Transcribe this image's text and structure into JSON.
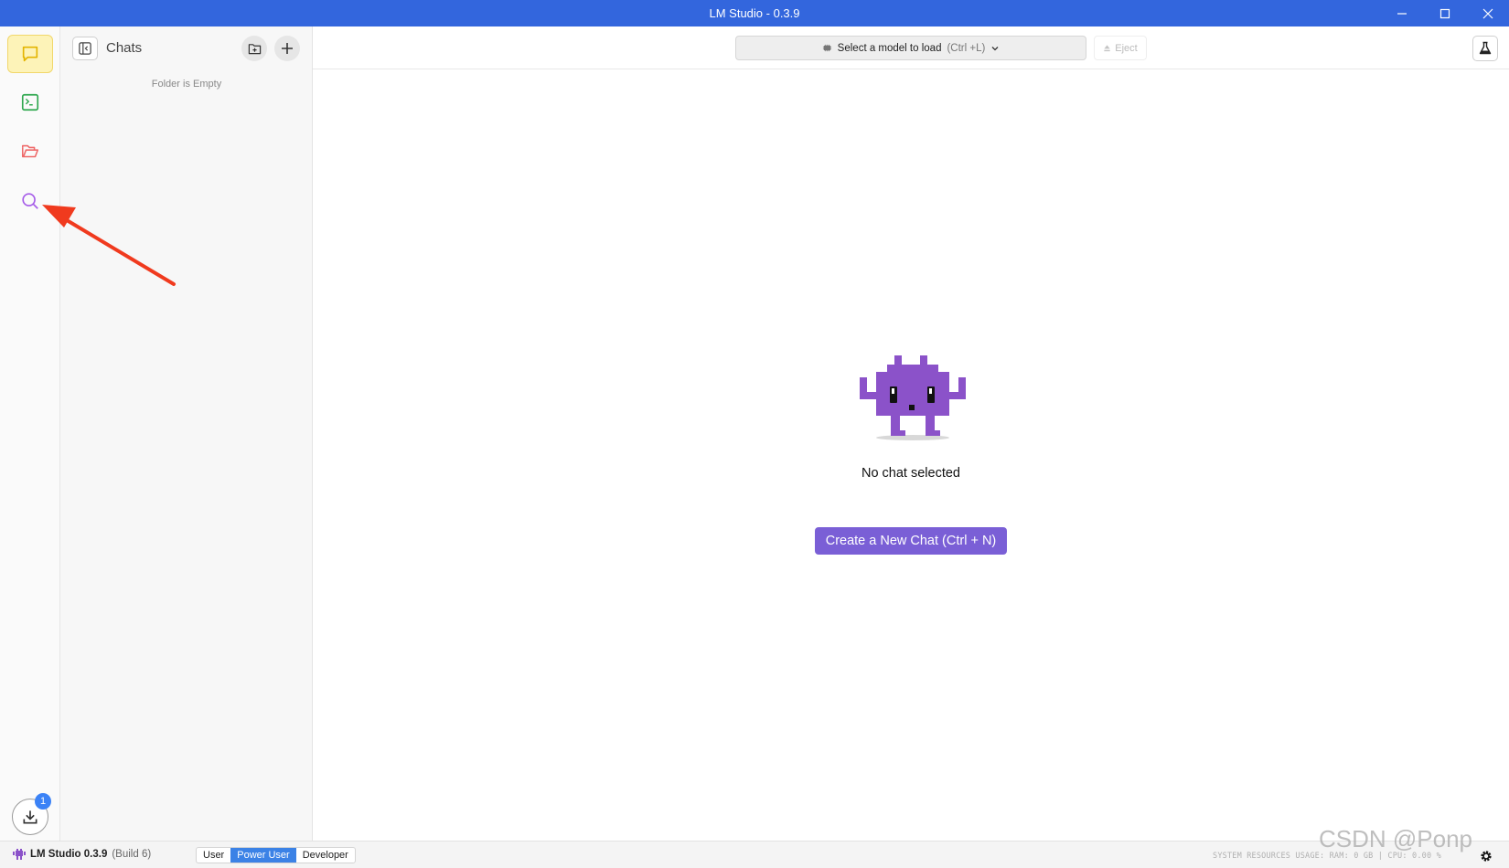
{
  "window": {
    "title": "LM Studio - 0.3.9"
  },
  "rail": {
    "items": [
      {
        "name": "chat",
        "icon": "chat-bubble-icon",
        "active": true,
        "color": "#e6b800"
      },
      {
        "name": "developer",
        "icon": "terminal-icon",
        "active": false,
        "color": "#2fa84f"
      },
      {
        "name": "my-models",
        "icon": "folder-open-icon",
        "active": false,
        "color": "#ee6a6a"
      },
      {
        "name": "discover",
        "icon": "search-icon",
        "active": false,
        "color": "#a55be8"
      }
    ],
    "download_badge": "1"
  },
  "chats": {
    "title": "Chats",
    "empty_text": "Folder is Empty"
  },
  "toolbar": {
    "model_select_label": "Select a model to load",
    "model_select_shortcut": "(Ctrl +L)",
    "eject_label": "Eject"
  },
  "main": {
    "empty_state": "No chat selected",
    "new_chat_button": "Create a New Chat (Ctrl + N)"
  },
  "statusbar": {
    "app_name": "LM Studio 0.3.9",
    "build": "(Build 6)",
    "modes": [
      "User",
      "Power User",
      "Developer"
    ],
    "active_mode": "Power User",
    "resources": "SYSTEM RESOURCES USAGE:   RAM: 0 GB  |  CPU: 0.00 %"
  },
  "watermark": "CSDN @Ponp",
  "colors": {
    "titlebar": "#3366dd",
    "accent": "#7a5fd6",
    "mascot": "#8b52c9",
    "annotation_arrow": "#f03a1e"
  }
}
